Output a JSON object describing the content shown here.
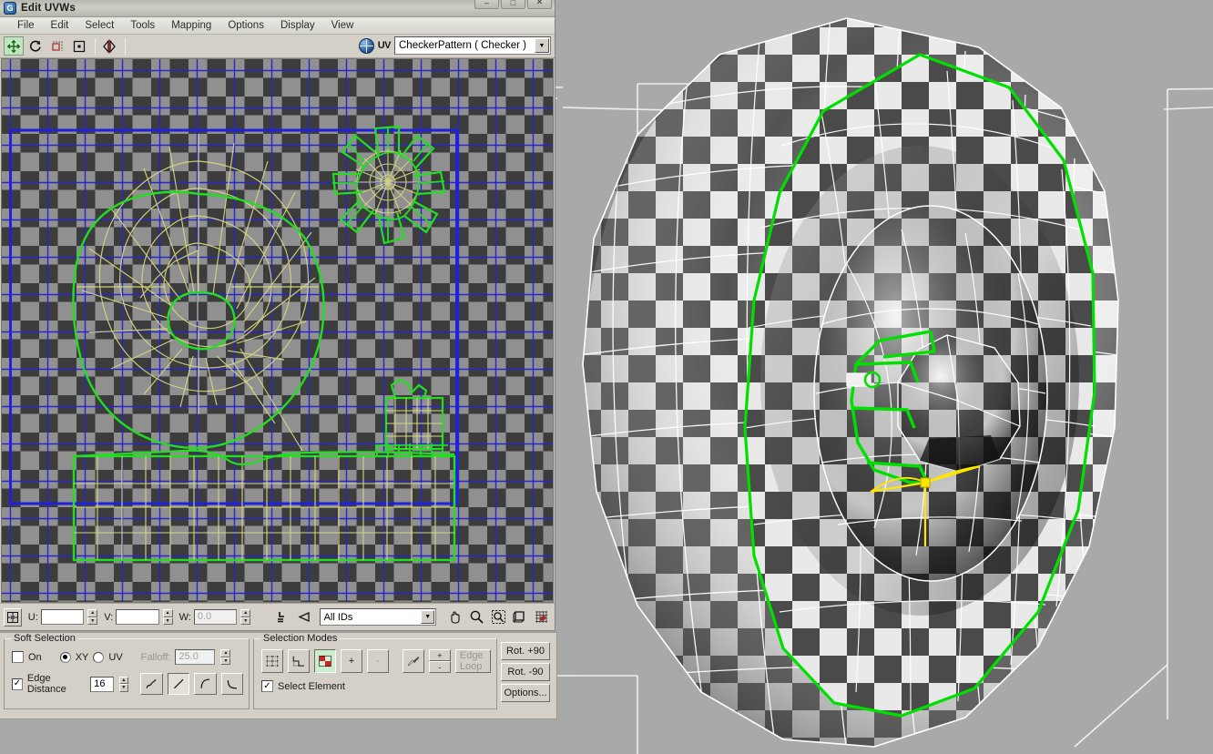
{
  "window": {
    "title": "Edit UVWs",
    "app_icon": "max-logo-icon",
    "controls": {
      "minimize": "–",
      "maximize": "□",
      "close": "✕"
    }
  },
  "menubar": {
    "items": [
      {
        "label": "File"
      },
      {
        "label": "Edit"
      },
      {
        "label": "Select"
      },
      {
        "label": "Tools"
      },
      {
        "label": "Mapping"
      },
      {
        "label": "Options"
      },
      {
        "label": "Display"
      },
      {
        "label": "View"
      }
    ]
  },
  "toolbar": {
    "tools": [
      {
        "name": "move-tool",
        "active": true
      },
      {
        "name": "rotate-tool",
        "active": false
      },
      {
        "name": "scale-tool",
        "active": false
      },
      {
        "name": "freeform-tool",
        "active": false
      },
      {
        "name": "mirror-tool",
        "active": false
      }
    ],
    "uv_label": "UV",
    "material": "CheckerPattern  ( Checker )",
    "dropdown_arrow": "▼"
  },
  "bottombar": {
    "u_label": "U:",
    "u_value": "",
    "v_label": "V:",
    "v_value": "",
    "w_label": "W:",
    "w_value": "0.0",
    "ids_value": "All IDs",
    "dropdown_arrow": "▼",
    "spin_up": "▲",
    "spin_down": "▼"
  },
  "soft_selection": {
    "title": "Soft Selection",
    "on_label": "On",
    "on_checked": false,
    "xy_label": "XY",
    "uv_label": "UV",
    "mode_selected": "XY",
    "falloff_label": "Falloff:",
    "falloff_value": "25.0",
    "falloff_enabled": false,
    "edge_distance_label": "Edge Distance",
    "edge_distance_checked": true,
    "edge_distance_value": "16",
    "curve_buttons": [
      {
        "name": "falloff-curve-smooth",
        "selected": false
      },
      {
        "name": "falloff-curve-linear",
        "selected": true
      },
      {
        "name": "falloff-curve-fast",
        "selected": false
      },
      {
        "name": "falloff-curve-slow",
        "selected": false
      }
    ]
  },
  "selection_modes": {
    "title": "Selection Modes",
    "buttons": [
      {
        "name": "vertex-sub-object",
        "selected": false
      },
      {
        "name": "edge-sub-object",
        "selected": false
      },
      {
        "name": "face-sub-object",
        "selected": true
      },
      {
        "name": "grow-selection",
        "label": "+",
        "selected": false
      },
      {
        "name": "shrink-selection",
        "label": "-",
        "selected": false
      },
      {
        "name": "paint-select-brush",
        "selected": false
      }
    ],
    "brush_plus": "+",
    "brush_minus": "-",
    "edge_loop_label": "Edge Loop",
    "edge_loop_enabled": false,
    "select_element_label": "Select Element",
    "select_element_checked": true
  },
  "rotate_panel": {
    "rot_plus_90": "Rot. +90",
    "rot_minus_90": "Rot. -90",
    "options": "Options..."
  },
  "colors": {
    "window_chrome": "#d4d0c8",
    "checker_dark": "#3a3a3a",
    "checker_light": "#909090",
    "grid_blue": "#2222cc",
    "shell_outline_green": "#22dd22",
    "shell_wire_yellow": "#d8d87a",
    "viewport_bg": "#a9a9a9",
    "mesh_wire_white": "#ffffff",
    "selected_edge_green": "#00dd00",
    "gizmo_yellow": "#ffee00"
  }
}
